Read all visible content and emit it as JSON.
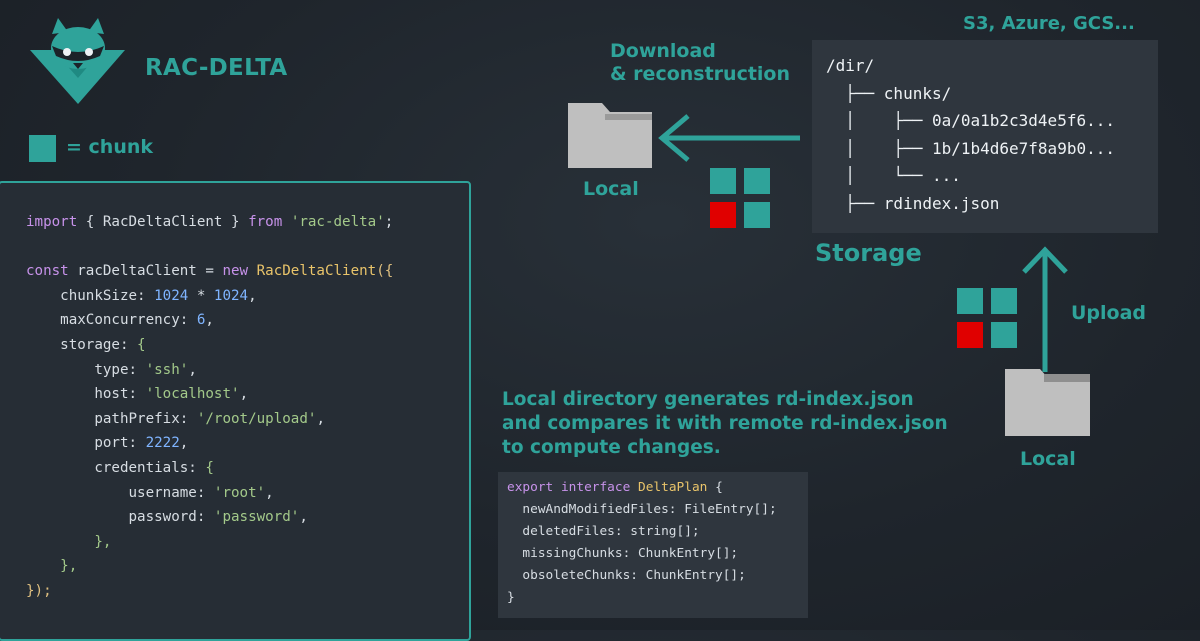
{
  "brand": {
    "name": "RAC-DELTA"
  },
  "legend": {
    "label": "= chunk",
    "color": "#2fa39a"
  },
  "colors": {
    "accent": "#2fa39a",
    "changed_chunk": "#e00000",
    "folder": "#bfbfbf"
  },
  "client_code": [
    [
      {
        "t": "kw",
        "v": "import"
      },
      {
        "t": "p",
        "v": " { RacDeltaClient } "
      },
      {
        "t": "kw",
        "v": "from"
      },
      {
        "t": "p",
        "v": " "
      },
      {
        "t": "str",
        "v": "'rac-delta'"
      },
      {
        "t": "p",
        "v": ";"
      }
    ],
    [],
    [
      {
        "t": "kw",
        "v": "const"
      },
      {
        "t": "p",
        "v": " racDeltaClient = "
      },
      {
        "t": "kw",
        "v": "new"
      },
      {
        "t": "p",
        "v": " "
      },
      {
        "t": "cls",
        "v": "RacDeltaClient"
      },
      {
        "t": "pn",
        "v": "({"
      }
    ],
    [
      {
        "t": "p",
        "v": "    chunkSize: "
      },
      {
        "t": "num",
        "v": "1024"
      },
      {
        "t": "p",
        "v": " * "
      },
      {
        "t": "num",
        "v": "1024"
      },
      {
        "t": "p",
        "v": ","
      }
    ],
    [
      {
        "t": "p",
        "v": "    maxConcurrency: "
      },
      {
        "t": "num",
        "v": "6"
      },
      {
        "t": "p",
        "v": ","
      }
    ],
    [
      {
        "t": "p",
        "v": "    storage: "
      },
      {
        "t": "str",
        "v": "{"
      }
    ],
    [
      {
        "t": "p",
        "v": "        type: "
      },
      {
        "t": "str",
        "v": "'ssh'"
      },
      {
        "t": "p",
        "v": ","
      }
    ],
    [
      {
        "t": "p",
        "v": "        host: "
      },
      {
        "t": "str",
        "v": "'localhost'"
      },
      {
        "t": "p",
        "v": ","
      }
    ],
    [
      {
        "t": "p",
        "v": "        pathPrefix: "
      },
      {
        "t": "str",
        "v": "'/root/upload'"
      },
      {
        "t": "p",
        "v": ","
      }
    ],
    [
      {
        "t": "p",
        "v": "        port: "
      },
      {
        "t": "num",
        "v": "2222"
      },
      {
        "t": "p",
        "v": ","
      }
    ],
    [
      {
        "t": "p",
        "v": "        credentials: "
      },
      {
        "t": "str",
        "v": "{"
      }
    ],
    [
      {
        "t": "p",
        "v": "            username: "
      },
      {
        "t": "str",
        "v": "'root'"
      },
      {
        "t": "p",
        "v": ","
      }
    ],
    [
      {
        "t": "p",
        "v": "            password: "
      },
      {
        "t": "str",
        "v": "'password'"
      },
      {
        "t": "p",
        "v": ","
      }
    ],
    [
      {
        "t": "str",
        "v": "        },"
      }
    ],
    [
      {
        "t": "str",
        "v": "    },"
      }
    ],
    [
      {
        "t": "pn",
        "v": "});"
      }
    ]
  ],
  "download": {
    "line1": "Download",
    "line2": "& reconstruction"
  },
  "storage": {
    "providers": "S3, Azure, GCS...",
    "label": "Storage",
    "tree": [
      "/dir/",
      "  ├── chunks/",
      "  │    ├── 0a/0a1b2c3d4e5f6...",
      "  │    ├── 1b/1b4d6e7f8a9b0...",
      "  │    └── ...",
      "  ├── rdindex.json"
    ]
  },
  "local_top": {
    "label": "Local"
  },
  "local_bottom": {
    "label": "Local"
  },
  "upload": {
    "label": "Upload"
  },
  "chunk_grid": [
    "unchanged",
    "unchanged",
    "changed",
    "unchanged"
  ],
  "description": [
    "Local directory generates rd-index.json",
    "and compares it with remote rd-index.json",
    "to compute changes."
  ],
  "delta_code": [
    [
      {
        "t": "kw",
        "v": "export"
      },
      {
        "t": "p",
        "v": " "
      },
      {
        "t": "kw",
        "v": "interface"
      },
      {
        "t": "p",
        "v": " "
      },
      {
        "t": "cls",
        "v": "DeltaPlan"
      },
      {
        "t": "p",
        "v": " {"
      }
    ],
    [
      {
        "t": "p",
        "v": "  newAndModifiedFiles: FileEntry[];"
      }
    ],
    [
      {
        "t": "p",
        "v": "  deletedFiles: "
      },
      {
        "t": "p",
        "v": "string"
      },
      {
        "t": "p",
        "v": "[];"
      }
    ],
    [
      {
        "t": "p",
        "v": "  missingChunks: ChunkEntry[];"
      }
    ],
    [
      {
        "t": "p",
        "v": "  obsoleteChunks: ChunkEntry[];"
      }
    ],
    [
      {
        "t": "p",
        "v": "}"
      }
    ]
  ]
}
